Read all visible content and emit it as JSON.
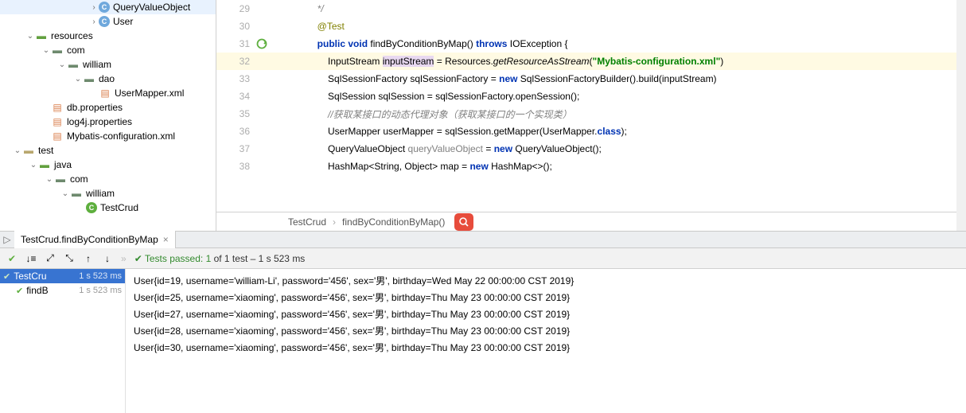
{
  "tree": {
    "qvo": "QueryValueObject",
    "user": "User",
    "resources": "resources",
    "com": "com",
    "william": "william",
    "dao": "dao",
    "usermapper": "UserMapper.xml",
    "dbprops": "db.properties",
    "log4j": "log4j.properties",
    "mybatiscfg": "Mybatis-configuration.xml",
    "test": "test",
    "java": "java",
    "testcrud": "TestCrud"
  },
  "code": {
    "l29": "        */",
    "l30_anno": "@Test",
    "l31_pub": "public",
    "l31_void": "void",
    "l31_name": " findByConditionByMap() ",
    "l31_throws": "throws",
    "l31_exc": " IOException {",
    "l32_a": "InputStream ",
    "l32_var": "inputStream",
    "l32_b": " = Resources.",
    "l32_m": "getResourceAsStream",
    "l32_c": "(",
    "l32_str": "\"Mybatis-configuration.xml\"",
    "l32_d": ")",
    "l33": "SqlSessionFactory sqlSessionFactory = ",
    "l33_new": "new",
    "l33_b": " SqlSessionFactoryBuilder().build(inputStream)",
    "l34": "SqlSession sqlSession = sqlSessionFactory.openSession();",
    "l35": "//获取某接口的动态代理对象（获取某接口的一个实现类）",
    "l36_a": "UserMapper userMapper = sqlSession.getMapper(UserMapper.",
    "l36_cls": "class",
    "l36_b": ");",
    "l37_a": "QueryValueObject ",
    "l37_g": "queryValueObject",
    "l37_b": " = ",
    "l37_new": "new",
    "l37_c": " QueryValueObject();",
    "l38_a": "HashMap<String, Object> map = ",
    "l38_new": "new",
    "l38_b": " HashMap<>();",
    "ln29": "29",
    "ln30": "30",
    "ln31": "31",
    "ln32": "32",
    "ln33": "33",
    "ln34": "34",
    "ln35": "35",
    "ln36": "36",
    "ln37": "37",
    "ln38": "38"
  },
  "breadcrumb": {
    "cls": "TestCrud",
    "mth": "findByConditionByMap()"
  },
  "run_tab": "TestCrud.findByConditionByMap",
  "status": {
    "prefix": "Tests passed: 1",
    "rest": " of 1 test – 1 s 523 ms"
  },
  "tests": {
    "root_name": "TestCru",
    "root_time": "1 s 523 ms",
    "leaf_name": "findB",
    "leaf_time": "1 s 523 ms"
  },
  "console": [
    "User{id=19, username='william-Li', password='456', sex='男', birthday=Wed May 22 00:00:00 CST 2019}",
    "User{id=25, username='xiaoming', password='456', sex='男', birthday=Thu May 23 00:00:00 CST 2019}",
    "User{id=27, username='xiaoming', password='456', sex='男', birthday=Thu May 23 00:00:00 CST 2019}",
    "User{id=28, username='xiaoming', password='456', sex='男', birthday=Thu May 23 00:00:00 CST 2019}",
    "User{id=30, username='xiaoming', password='456', sex='男', birthday=Thu May 23 00:00:00 CST 2019}"
  ]
}
